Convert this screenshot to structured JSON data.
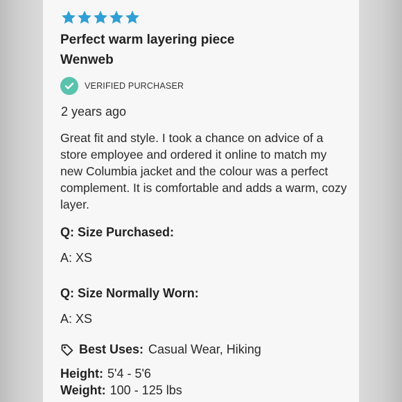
{
  "review": {
    "rating": 5,
    "rating_max": 5,
    "star_color": "#2f9fd4",
    "title": "Perfect warm layering piece",
    "author": "Wenweb",
    "verified_label": "VERIFIED PURCHASER",
    "verified_color": "#5ac3ad",
    "date": "2 years ago",
    "body": "Great fit and style. I took a chance on advice of a store employee and ordered it online to match my new Columbia jacket and the colour was a perfect complement. It is comfortable and adds a warm, cozy layer."
  },
  "questions": [
    {
      "q": "Q: Size Purchased:",
      "a": "A: XS"
    },
    {
      "q": "Q: Size Normally Worn:",
      "a": "A: XS"
    }
  ],
  "best_uses": {
    "icon": "tag-icon",
    "label": "Best Uses:",
    "value": "Casual Wear, Hiking"
  },
  "height": {
    "label": "Height:",
    "value": "5'4 - 5'6"
  },
  "weight": {
    "label": "Weight:",
    "value": "100 - 125 lbs"
  }
}
